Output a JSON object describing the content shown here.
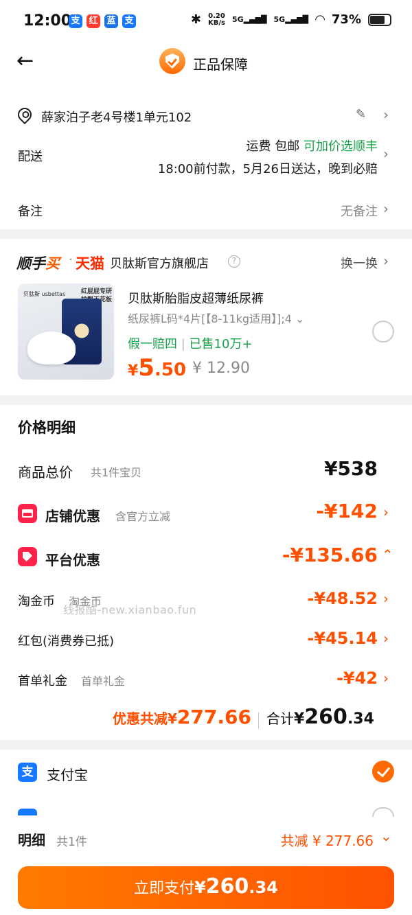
{
  "status_bar": {
    "time": "12:00",
    "app_icons": [
      "支",
      "红",
      "蓝",
      "支"
    ],
    "net_speed_top": "0.20",
    "net_speed_unit": "KB/s",
    "sim1": "5G",
    "sim2": "5G",
    "battery": "73%"
  },
  "header": {
    "title": "正品保障"
  },
  "address": {
    "text": "薛家泊子老4号楼1单元102"
  },
  "delivery": {
    "label": "配送",
    "fee_label": "运费 包邮",
    "upgrade": "可加价选顺丰",
    "eta": "18:00前付款，5月26日送达，晚到必赔"
  },
  "remark": {
    "label": "备注",
    "value": "无备注"
  },
  "store": {
    "logo_a": "顺手",
    "logo_b": "买",
    "dot": "·",
    "tmall": "天猫",
    "name": "贝肽斯官方旗舰店",
    "switch": "换一换"
  },
  "product": {
    "image_brand": "贝肽斯 usbettas",
    "image_tag_1": "红屁屁专研",
    "image_tag_2": "护臀天花板",
    "title": "贝肽斯胎脂皮超薄纸尿裤",
    "spec": "纸尿裤L码*4片[【8-11kg适用】];4",
    "guarantee": "假一赔四",
    "separator": "|",
    "sold": "已售10万+",
    "price_symbol": "¥",
    "price_int": "5",
    "price_dec": ".50",
    "original_price": "¥ 12.90"
  },
  "price_detail": {
    "title": "价格明细",
    "total_label": "商品总价",
    "total_sub": "共1件宝贝",
    "total_value": "¥538",
    "store_discount_label": "店铺优惠",
    "store_discount_sub": "含官方立减",
    "store_discount_value": "-¥142",
    "platform_discount_label": "平台优惠",
    "platform_discount_value": "-¥135.66",
    "coin_label": "淘金币",
    "coin_sub": "淘金币",
    "coin_value": "-¥48.52",
    "redpacket_label": "红包(消费券已抵)",
    "redpacket_value": "-¥45.14",
    "firstorder_label": "首单礼金",
    "firstorder_sub": "首单礼金",
    "firstorder_value": "-¥42",
    "saving_label": "优惠共减",
    "saving_symbol": "¥",
    "saving_value": "277.66",
    "sum_label": "合计",
    "sum_symbol": "¥",
    "sum_int": "260",
    "sum_dec": ".34"
  },
  "watermark": "线报酷-new.xianbao.fun",
  "payment": {
    "alipay_icon": "支",
    "alipay_label": "支付宝"
  },
  "footer": {
    "detail_label": "明细",
    "detail_count": "共1件",
    "saving_text": "共减 ¥ 277.66",
    "pay_label": "立即支付",
    "pay_symbol": "¥",
    "pay_int": "260",
    "pay_dec": ".34"
  },
  "colors": {
    "accent": "#ff5000",
    "green": "#18a24a",
    "alipay": "#1677ff",
    "red_icon": "#ff2249"
  }
}
